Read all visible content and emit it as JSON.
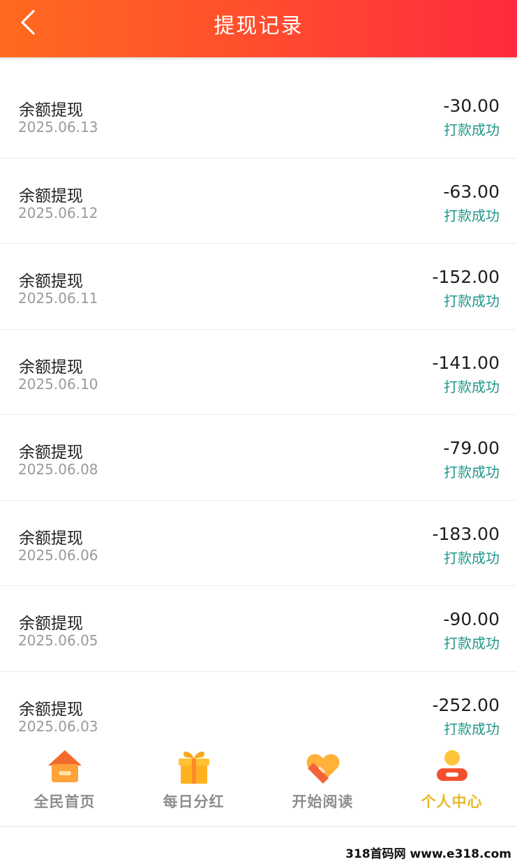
{
  "header": {
    "title": "提现记录"
  },
  "records": [
    {
      "title": "余额提现",
      "date": "2025.06.13",
      "amount": "-30.00",
      "status": "打款成功"
    },
    {
      "title": "余额提现",
      "date": "2025.06.12",
      "amount": "-63.00",
      "status": "打款成功"
    },
    {
      "title": "余额提现",
      "date": "2025.06.11",
      "amount": "-152.00",
      "status": "打款成功"
    },
    {
      "title": "余额提现",
      "date": "2025.06.10",
      "amount": "-141.00",
      "status": "打款成功"
    },
    {
      "title": "余额提现",
      "date": "2025.06.08",
      "amount": "-79.00",
      "status": "打款成功"
    },
    {
      "title": "余额提现",
      "date": "2025.06.06",
      "amount": "-183.00",
      "status": "打款成功"
    },
    {
      "title": "余额提现",
      "date": "2025.06.05",
      "amount": "-90.00",
      "status": "打款成功"
    },
    {
      "title": "余额提现",
      "date": "2025.06.03",
      "amount": "-252.00",
      "status": "打款成功"
    }
  ],
  "tabs": [
    {
      "label": "全民首页",
      "icon": "home-icon",
      "active": false
    },
    {
      "label": "每日分红",
      "icon": "gift-icon",
      "active": false
    },
    {
      "label": "开始阅读",
      "icon": "heart-tag-icon",
      "active": false
    },
    {
      "label": "个人中心",
      "icon": "person-icon",
      "active": true
    }
  ],
  "colors": {
    "header_start": "#ff6a1f",
    "header_end": "#ff2a3f",
    "status_text": "#21968a",
    "active_tab": "#e8b922"
  },
  "watermark": "318首码网 www.e318.com"
}
